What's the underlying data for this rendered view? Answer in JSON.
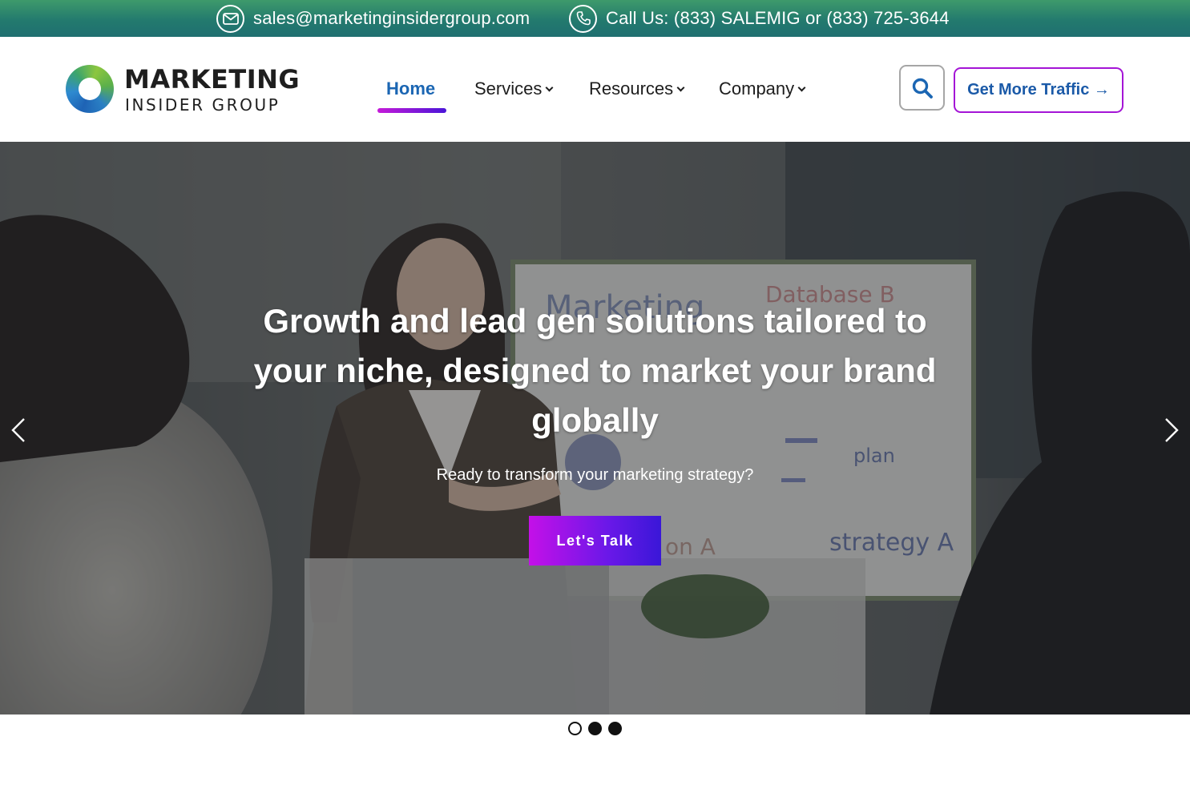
{
  "topbar": {
    "email": "sales@marketinginsidergroup.com",
    "phone": "Call Us: (833) SALEMIG or (833) 725-3644",
    "email_icon": "envelope-icon",
    "phone_icon": "phone-icon"
  },
  "logo": {
    "line1": "MARKETING",
    "line2": "INSIDER GROUP"
  },
  "nav": {
    "items": [
      {
        "label": "Home",
        "active": true
      },
      {
        "label": "Services",
        "dropdown": true
      },
      {
        "label": "Resources",
        "dropdown": true
      },
      {
        "label": "Company",
        "dropdown": true
      }
    ]
  },
  "header": {
    "search_icon": "search-icon",
    "cta_label": "Get More Traffic →"
  },
  "hero": {
    "title": "Growth and lead gen solutions tailored to your niche, designed to market your brand globally",
    "subtitle": "Ready to transform your marketing strategy?",
    "button_label": "Let's Talk",
    "slides_total": 3,
    "slide_current": 1
  },
  "colors": {
    "topbar": "#237a6e",
    "brand_blue": "#1b66b3",
    "accent_magenta": "#c410e8",
    "accent_violet": "#3a17d8"
  }
}
